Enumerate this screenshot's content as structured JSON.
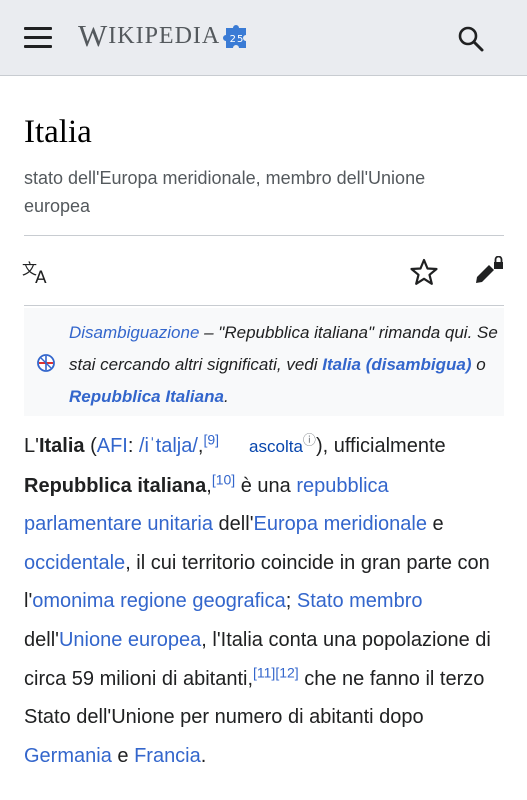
{
  "header": {
    "wordmark_big_w": "W",
    "wordmark_rest": "IKIPEDIA",
    "wordmark_big_a": "A",
    "puzzle_badge": "25"
  },
  "page": {
    "title": "Italia",
    "tagline": "stato dell'Europa meridionale, membro dell'Unione europea"
  },
  "hatnote": {
    "link1": "Disambiguazione",
    "text1": " – \"Repubblica italiana\" rimanda qui. Se stai cercando altri significati, vedi ",
    "link2": "Italia (disambigua)",
    "text2": " o ",
    "link3": "Repubblica Italiana",
    "text3": "."
  },
  "body": {
    "t1": "L'",
    "italia": "Italia",
    "t2": " (",
    "afi": "AFI",
    "t3": ": ",
    "ipa": "/iˈtalja/",
    "t4": ",",
    "ref9": "[9]",
    "ascolta": "ascolta",
    "info": "ⓘ",
    "t5": "), ufficialmente ",
    "repubblica": "Repubblica italiana",
    "t6": ",",
    "ref10": "[10]",
    "t7": " è una ",
    "l1": "repubblica parlamentare unitaria",
    "t8": " dell'",
    "l2": "Europa meridionale",
    "t9": " e ",
    "l3": "occidentale",
    "t10": ", il cui territorio coincide in gran parte con l'",
    "l4": "omonima regione geografica",
    "t11": "; ",
    "l5": "Stato membro",
    "t12": " dell'",
    "l6": "Unione europea",
    "t13": ", l'Italia conta una popolazione di circa 59 milioni di abitanti,",
    "ref11": "[11]",
    "ref12": "[12]",
    "t14": " che ne fanno il terzo Stato dell'Unione per numero di abitanti dopo ",
    "l7": "Germania",
    "t15": " e ",
    "l8": "Francia",
    "t16": "."
  }
}
